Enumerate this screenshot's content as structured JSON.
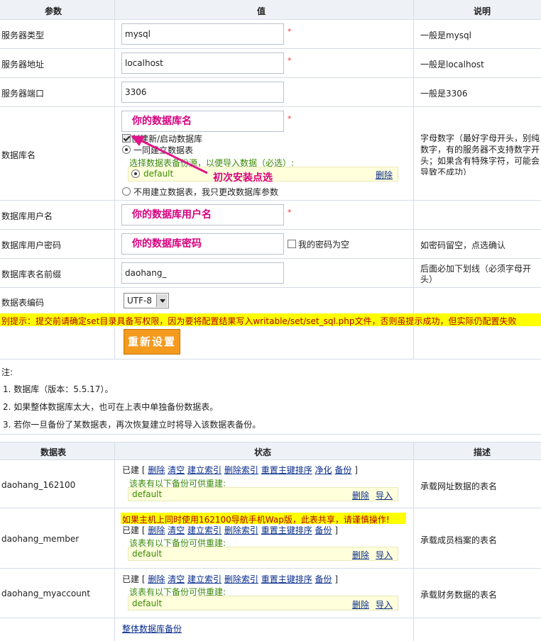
{
  "config_table": {
    "headers": {
      "param": "参数",
      "value": "值",
      "desc": "说明"
    },
    "rows": {
      "server_type": {
        "label": "服务器类型",
        "value": "mysql",
        "note": "一般是mysql"
      },
      "server_addr": {
        "label": "服务器地址",
        "value": "localhost",
        "note": "一般是localhost"
      },
      "server_port": {
        "label": "服务器端口",
        "value": "3306",
        "note": "一般是3306"
      },
      "db_name": {
        "label": "数据库名",
        "value": "你的数据库名",
        "create_db_label": "创建新/启动数据库",
        "build_tables_label": "一同建立数据表",
        "backup_select_label": "选择数据表备份源，以便导入数据（必选）:",
        "backup_option": "default",
        "delete_link": "删除",
        "no_tables_label": "不用建立数据表，我只更改数据库参数",
        "annotation": "初次安装点选",
        "note": "字母数字（最好字母开头，别纯数字，有的服务器不支持数字开头；如果含有特殊字符，可能会导致不成功）"
      },
      "db_user": {
        "label": "数据库用户名",
        "value": "你的数据库用户名"
      },
      "db_pass": {
        "label": "数据库用户密码",
        "value": "你的数据库密码",
        "empty_label": "我的密码为空",
        "note": "如密码留空，点选确认"
      },
      "table_prefix": {
        "label": "数据库表名前缀",
        "value": "daohang_",
        "note": "后面必加下划线（必须字母开头）"
      },
      "encoding": {
        "label": "数据表编码",
        "selected": "UTF-8"
      }
    },
    "warning": "别提示：提交前请确定set目录具备写权限，因为要将配置结果写入writable/set/set_sql.php文件，否则虽提示成功，但实际仍配置失败",
    "reset_button": "重新设置"
  },
  "notes": {
    "title": "注:",
    "items": [
      "1. 数据库（版本：5.5.17）。",
      "2. 如果整体数据库太大，也可在上表中单独备份数据表。",
      "3. 若你一旦备份了某数据表，再次恢复建立时将导入该数据表备份。"
    ]
  },
  "tables_table": {
    "headers": {
      "table": "数据表",
      "status": "状态",
      "desc": "描述"
    },
    "rows": [
      {
        "name": "daohang_162100",
        "status_prefix": "已建 [",
        "actions": [
          "删除",
          "清空",
          "建立索引",
          "删除索引",
          "重置主键排序",
          "净化",
          "备份"
        ],
        "status_suffix": "]",
        "backup_label": "该表有以下备份可供重建:",
        "backup_name": "default",
        "delete_link": "删除",
        "import_link": "导入",
        "desc": "承载网址数据的表名"
      },
      {
        "name": "daohang_member",
        "warning": "如果主机上同时使用162100导航手机Wap版，此表共享，请谨慎操作!",
        "status_prefix": "已建 [",
        "actions": [
          "删除",
          "清空",
          "建立索引",
          "删除索引",
          "重置主键排序",
          "备份"
        ],
        "status_suffix": "]",
        "backup_label": "该表有以下备份可供重建:",
        "backup_name": "default",
        "delete_link": "删除",
        "import_link": "导入",
        "desc": "承载成员档案的表名"
      },
      {
        "name": "daohang_myaccount",
        "status_prefix": "已建 [",
        "actions": [
          "删除",
          "清空",
          "建立索引",
          "删除索引",
          "重置主键排序",
          "备份"
        ],
        "status_suffix": "]",
        "backup_label": "该表有以下备份可供重建:",
        "backup_name": "default",
        "delete_link": "删除",
        "import_link": "导入",
        "desc": "承载财务数据的表名"
      }
    ],
    "full_backup_link": "整体数据库备份"
  },
  "colors": {
    "header_bg": "#eef2f7",
    "warning_bg": "#ffff00",
    "warning_text": "#b00000",
    "annotation": "#d6007f",
    "button": "#f49a1d",
    "link": "#0a2e8c",
    "green_text": "#3a8a00"
  }
}
